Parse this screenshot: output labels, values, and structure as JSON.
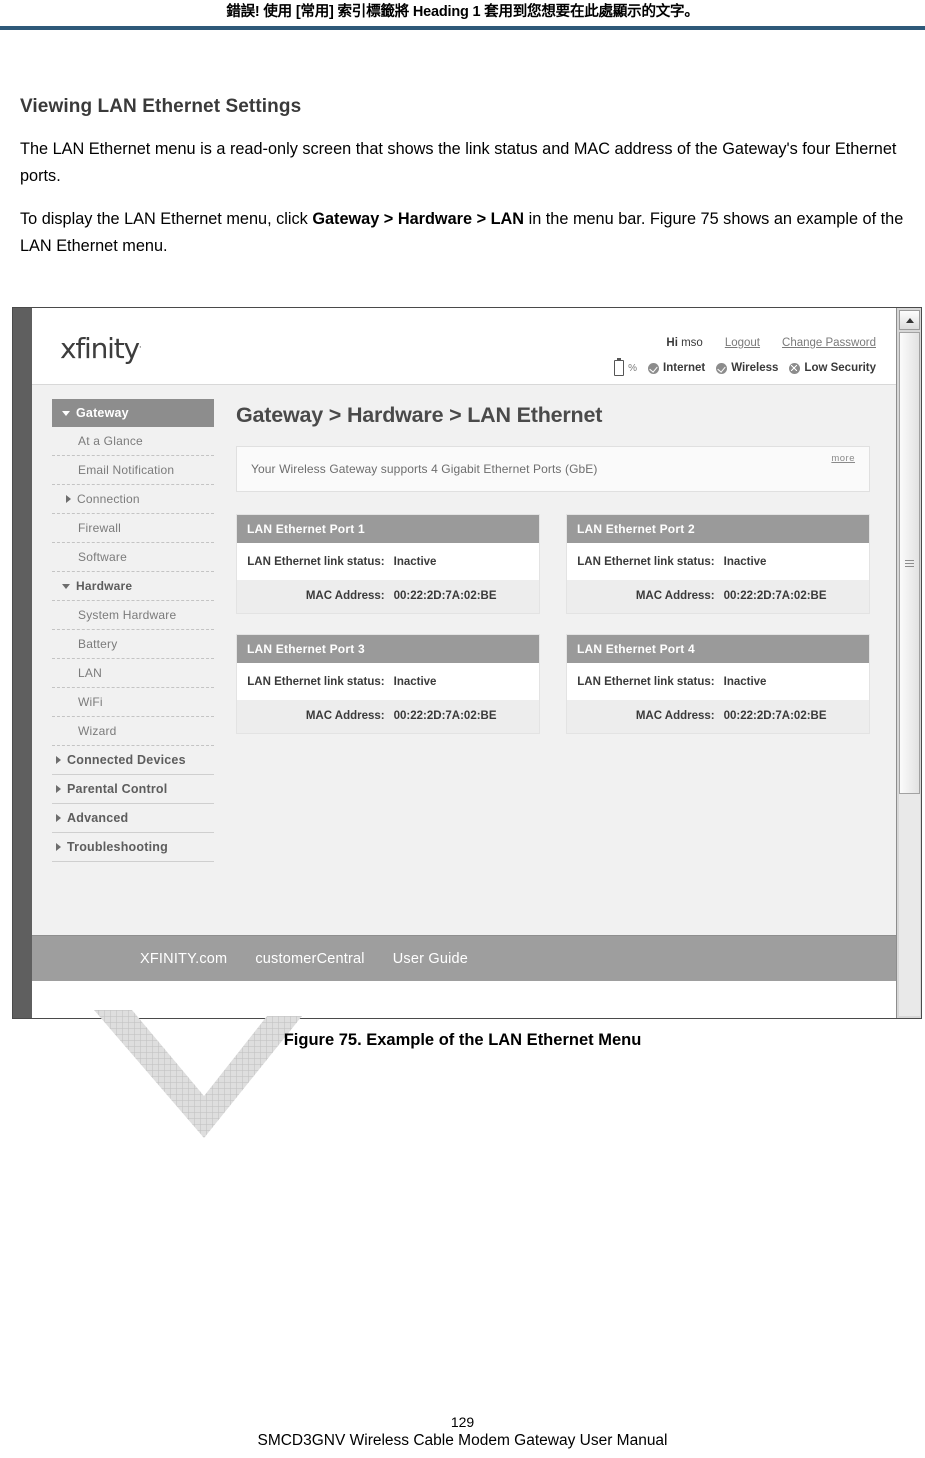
{
  "document": {
    "header_text": "錯誤! 使用 [常用] 索引標籤將 Heading 1 套用到您想要在此處顯示的文字。",
    "header_rule_color": "#2e5979",
    "section_title": "Viewing LAN Ethernet Settings",
    "paragraph_1": "The LAN Ethernet menu is a read-only screen that shows the link status and MAC address of the Gateway's four Ethernet ports.",
    "paragraph_2_before": "To display the LAN Ethernet menu, click ",
    "paragraph_2_bold": "Gateway > Hardware > LAN",
    "paragraph_2_after": " in the menu bar. Figure 75 shows an example of the LAN Ethernet menu.",
    "figure_caption": "Figure 75. Example of the LAN Ethernet Menu",
    "page_number": "129",
    "manual_title": "SMCD3GNV Wireless Cable Modem Gateway User Manual"
  },
  "screenshot": {
    "topbar": {
      "logo_text": "xfinity",
      "logo_tm": ".",
      "greeting_label": "Hi",
      "greeting_user": "mso",
      "logout_label": "Logout",
      "change_password_label": "Change Password",
      "battery_pct_label": "%",
      "status": [
        {
          "icon": "check-circle-icon",
          "label": "Internet"
        },
        {
          "icon": "check-circle-icon",
          "label": "Wireless"
        },
        {
          "icon": "alert-circle-icon",
          "label": "Low Security"
        }
      ]
    },
    "sidebar": {
      "header": {
        "label": "Gateway",
        "icon": "caret-down-icon",
        "active": true
      },
      "items": [
        {
          "label": "At a Glance",
          "type": "sub",
          "icon": null
        },
        {
          "label": "Email Notification",
          "type": "sub",
          "icon": null
        },
        {
          "label": "Connection",
          "type": "sub",
          "icon": "caret-right-icon"
        },
        {
          "label": "Firewall",
          "type": "sub",
          "icon": null
        },
        {
          "label": "Software",
          "type": "sub",
          "icon": null
        },
        {
          "label": "Hardware",
          "type": "group-inner",
          "icon": "caret-down-icon"
        },
        {
          "label": "System Hardware",
          "type": "sub2",
          "icon": null
        },
        {
          "label": "Battery",
          "type": "sub2",
          "icon": null
        },
        {
          "label": "LAN",
          "type": "sub2",
          "icon": null
        },
        {
          "label": "WiFi",
          "type": "sub2",
          "icon": null
        },
        {
          "label": "Wizard",
          "type": "sub2",
          "icon": null
        },
        {
          "label": "Connected Devices",
          "type": "group",
          "icon": "caret-right-icon"
        },
        {
          "label": "Parental Control",
          "type": "group",
          "icon": "caret-right-icon"
        },
        {
          "label": "Advanced",
          "type": "group",
          "icon": "caret-right-icon"
        },
        {
          "label": "Troubleshooting",
          "type": "group",
          "icon": "caret-right-icon"
        }
      ]
    },
    "main": {
      "page_title": "Gateway > Hardware > LAN Ethernet",
      "info_text": "Your Wireless Gateway supports 4 Gigabit Ethernet Ports (GbE)",
      "more_label": "more",
      "link_status_label": "LAN Ethernet link status:",
      "mac_label": "MAC Address:",
      "ports": [
        {
          "title": "LAN Ethernet Port 1",
          "link_status": "Inactive",
          "mac": "00:22:2D:7A:02:BE"
        },
        {
          "title": "LAN Ethernet Port 2",
          "link_status": "Inactive",
          "mac": "00:22:2D:7A:02:BE"
        },
        {
          "title": "LAN Ethernet Port 3",
          "link_status": "Inactive",
          "mac": "00:22:2D:7A:02:BE"
        },
        {
          "title": "LAN Ethernet Port 4",
          "link_status": "Inactive",
          "mac": "00:22:2D:7A:02:BE"
        }
      ]
    },
    "footer": {
      "links": [
        {
          "label": "XFINITY.com"
        },
        {
          "label": "customerCentral"
        },
        {
          "label": "User Guide"
        }
      ]
    },
    "colors": {
      "nav_active_bg": "#8d8d8d",
      "port_header_bg": "#9a9a9a",
      "footer_bg": "#9e9e9e",
      "page_bg": "#f1f1f1"
    }
  }
}
